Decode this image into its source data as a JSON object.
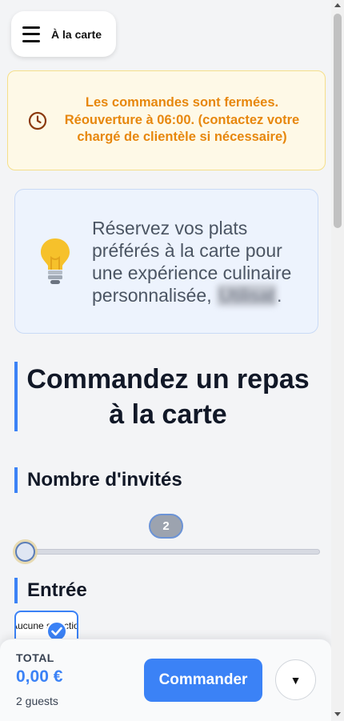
{
  "header": {
    "menu_label": "À la carte"
  },
  "notice": {
    "text": "Les commandes sont fermées. Réouverture à 06:00. (contactez votre chargé de clientèle si nécessaire)",
    "color": "#e7870d"
  },
  "info": {
    "text": "Réservez vos plats préférés à la carte pour une expérience culinaire personnalisée,",
    "name_redacted": "Utilisat",
    "trailing": "."
  },
  "page": {
    "title": "Commandez un repas à la carte"
  },
  "guests": {
    "heading": "Nombre d'invités",
    "value": "2",
    "fraction": 0.0
  },
  "entree": {
    "heading": "Entrée",
    "option_label": "Aucune sélection",
    "selected": true
  },
  "footer": {
    "total_label": "TOTAL",
    "total_value": "0,00 €",
    "guests_text": "2 guests",
    "order_label": "Commander",
    "expand_symbol": "▼"
  },
  "colors": {
    "accent": "#3b82f6",
    "warning_bg": "#fef9e7",
    "info_bg": "#edf3fd"
  }
}
